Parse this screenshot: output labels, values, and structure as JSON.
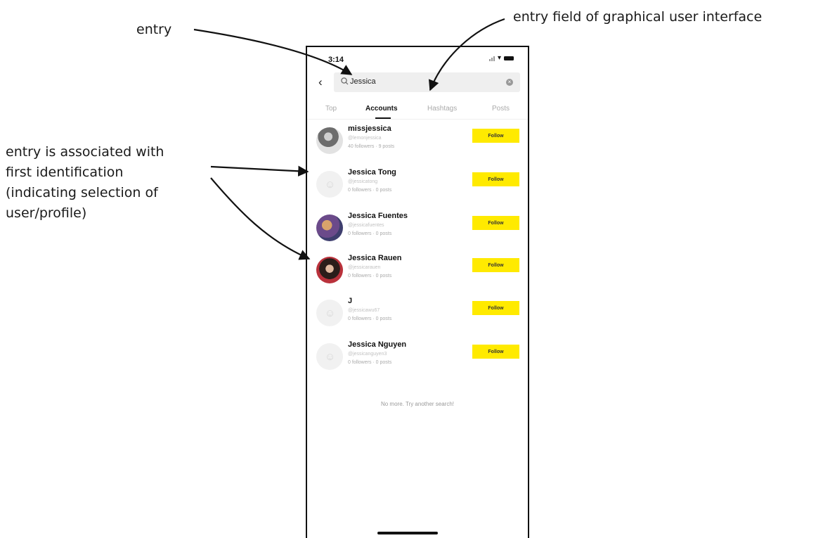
{
  "callouts": {
    "entry": "entry",
    "entry_field": "entry field of graphical user interface",
    "association": [
      "entry is associated with",
      "first identification",
      "(indicating selection of",
      "user/profile)"
    ]
  },
  "phone": {
    "time": "3:14",
    "search": {
      "query": "Jessica",
      "icons": {
        "back": "back-chevron-icon",
        "search": "magnifier-icon",
        "clear": "clear-icon"
      }
    },
    "tabs": [
      "Top",
      "Accounts",
      "Hashtags",
      "Posts"
    ],
    "active_tab": "Accounts",
    "accounts": [
      {
        "name": "missjessica",
        "handle": "@lemonjessica",
        "stats": "40 followers · 9 posts",
        "follow_label": "Follow",
        "avatar": "photo"
      },
      {
        "name": "Jessica Tong",
        "handle": "@jessicatong",
        "stats": "0 followers · 0 posts",
        "follow_label": "Follow",
        "avatar": "placeholder"
      },
      {
        "name": "Jessica Fuentes",
        "handle": "@jessicafuentes",
        "stats": "0 followers · 0 posts",
        "follow_label": "Follow",
        "avatar": "photo"
      },
      {
        "name": "Jessica Rauen",
        "handle": "@jessicarauen",
        "stats": "0 followers · 0 posts",
        "follow_label": "Follow",
        "avatar": "photo"
      },
      {
        "name": "J",
        "handle": "@jessicawu67",
        "stats": "0 followers · 0 posts",
        "follow_label": "Follow",
        "avatar": "placeholder"
      },
      {
        "name": "Jessica Nguyen",
        "handle": "@jessicanguyen3",
        "stats": "0 followers · 0 posts",
        "follow_label": "Follow",
        "avatar": "placeholder"
      }
    ],
    "end_message": "No more. Try another search!"
  },
  "colors": {
    "follow_button": "#ffea00",
    "text": "#111111",
    "muted": "#aaaaaa"
  }
}
